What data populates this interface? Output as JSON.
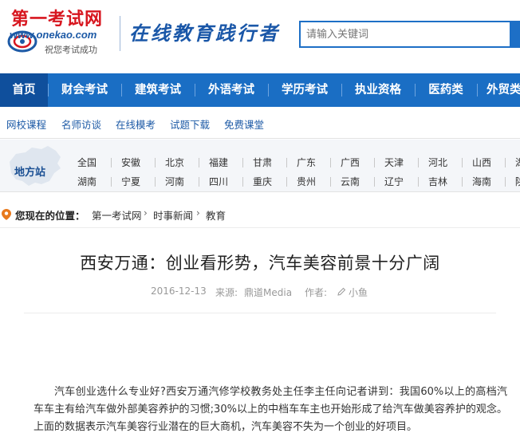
{
  "header": {
    "logo_title": "第一考试网",
    "logo_url": "www.onekao.com",
    "logo_slogan": "祝您考试成功",
    "tagline": "在线教育践行者",
    "search_placeholder": "请输入关键词"
  },
  "main_nav": [
    {
      "label": "首页",
      "active": true
    },
    {
      "label": "财会考试"
    },
    {
      "label": "建筑考试"
    },
    {
      "label": "外语考试"
    },
    {
      "label": "学历考试"
    },
    {
      "label": "执业资格"
    },
    {
      "label": "医药类"
    },
    {
      "label": "外贸类"
    }
  ],
  "sub_nav": [
    "网校课程",
    "名师访谈",
    "在线模考",
    "试题下载",
    "免费课堂"
  ],
  "regions": {
    "title": "地方站",
    "row1": [
      "全国",
      "安徽",
      "北京",
      "福建",
      "甘肃",
      "广东",
      "广西",
      "天津",
      "河北",
      "山西",
      "湖"
    ],
    "row2": [
      "湖南",
      "宁夏",
      "河南",
      "四川",
      "重庆",
      "贵州",
      "云南",
      "辽宁",
      "吉林",
      "海南",
      "陕"
    ]
  },
  "breadcrumb": {
    "label": "您现在的位置：",
    "items": [
      "第一考试网",
      "时事新闻",
      "教育"
    ],
    "separator": "›"
  },
  "article": {
    "title": "西安万通：创业看形势，汽车美容前景十分广阔",
    "date": "2016-12-13",
    "source_label": "来源:",
    "source": "鼎道Media",
    "author_label": "作者:",
    "author": "小鱼",
    "paragraph": "汽车创业选什么专业好?西安万通汽修学校教务处主任李主任向记者讲到：我国60%以上的高档汽车车主有给汽车做外部美容养护的习惯;30%以上的中档车车主也开始形成了给汽车做美容养护的观念。上面的数据表示汽车美容行业潜在的巨大商机，汽车美容不失为一个创业的好项目。"
  },
  "colors": {
    "nav_blue": "#1a6ec4",
    "nav_active": "#0f4f9c",
    "logo_red": "#d7161f",
    "link_blue": "#1d5aa6"
  }
}
